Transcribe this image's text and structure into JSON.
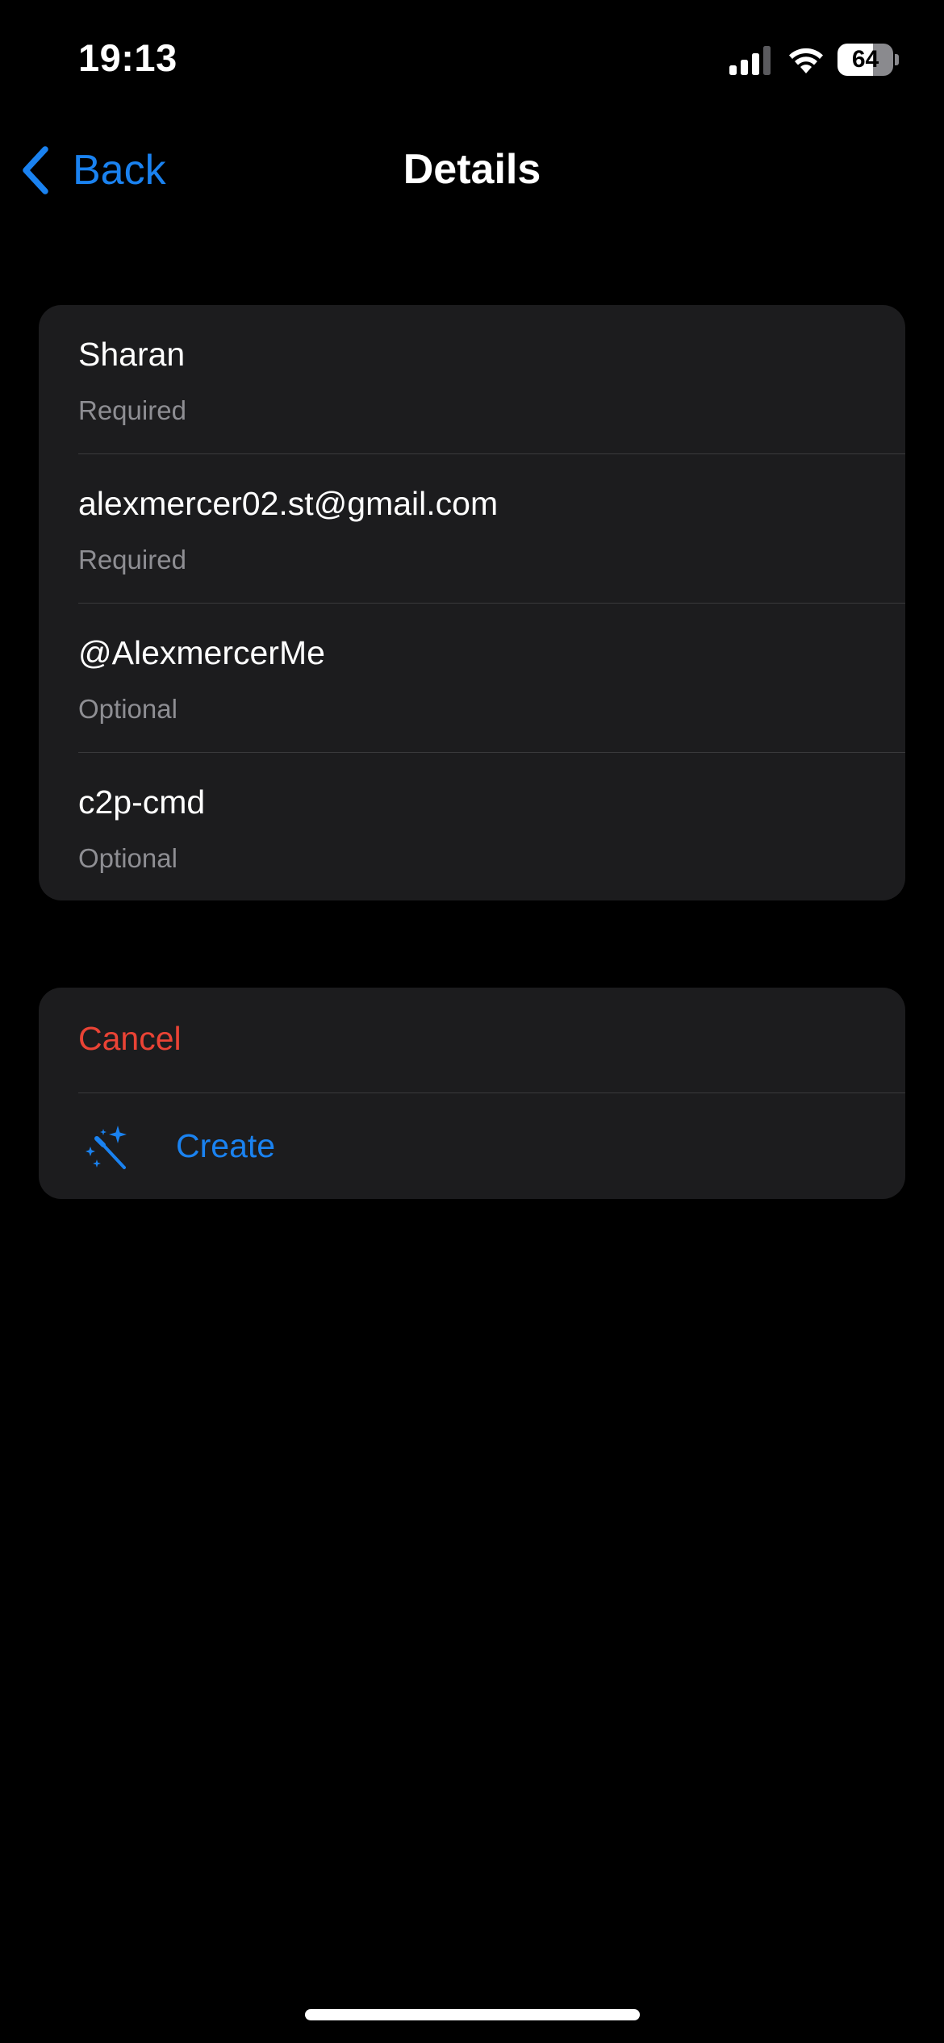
{
  "status_bar": {
    "time": "19:13",
    "battery_level": "64",
    "battery_fraction": 0.64,
    "signal_icon": "cellular-signal-icon",
    "wifi_icon": "wifi-icon"
  },
  "nav": {
    "back_label": "Back",
    "back_icon": "chevron-left-icon",
    "title": "Details"
  },
  "fields": [
    {
      "value": "Sharan",
      "hint": "Required"
    },
    {
      "value": "alexmercer02.st@gmail.com",
      "hint": "Required"
    },
    {
      "value": "@AlexmercerMe",
      "hint": "Optional"
    },
    {
      "value": "c2p-cmd",
      "hint": "Optional"
    }
  ],
  "actions": {
    "cancel_label": "Cancel",
    "create_label": "Create",
    "create_icon": "magic-wand-icon"
  },
  "colors": {
    "accent": "#1a82f0",
    "destructive": "#ea4335",
    "background": "#000000",
    "card": "#1c1c1e",
    "secondary_text": "#8e8e93"
  }
}
